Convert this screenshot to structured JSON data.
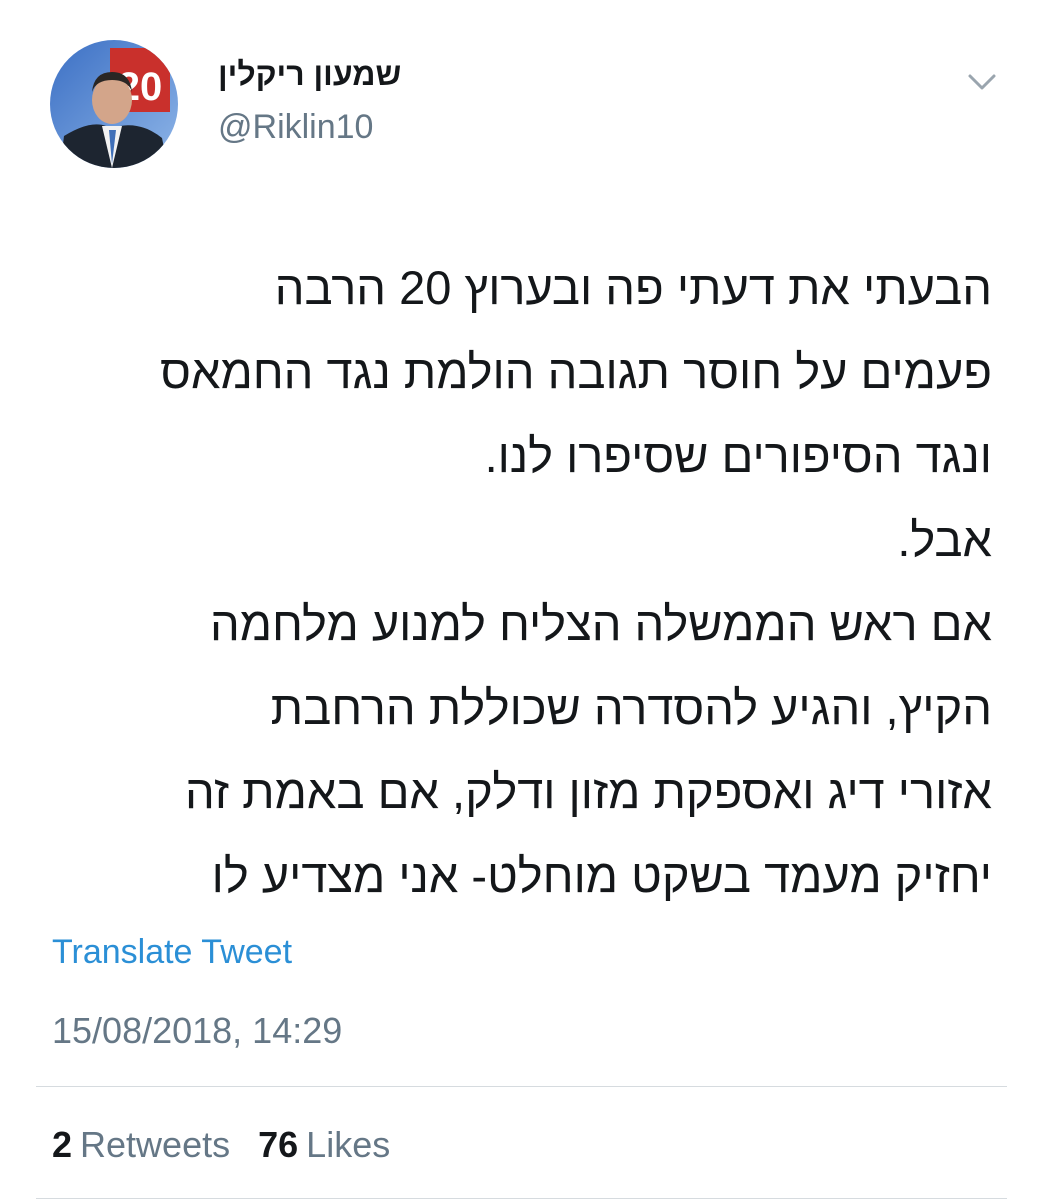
{
  "author": {
    "display_name": "שמעון ריקלין",
    "handle": "@Riklin10",
    "avatar_text": "20"
  },
  "tweet": {
    "lines": [
      "הבעתי את דעתי פה ובערוץ 20 הרבה",
      "פעמים על חוסר תגובה הולמת נגד החמאס",
      "ונגד הסיפורים שסיפרו לנו.",
      "אבל.",
      "אם ראש הממשלה הצליח למנוע מלחמה",
      "הקיץ, והגיע להסדרה שכוללת הרחבת",
      "אזורי דיג ואספקת מזון ודלק, אם באמת זה",
      "יחזיק מעמד בשקט מוחלט- אני מצדיע לו"
    ],
    "translate_label": "Translate Tweet",
    "timestamp": "15/08/2018, 14:29"
  },
  "stats": {
    "retweets_count": "2",
    "retweets_label": "Retweets",
    "likes_count": "76",
    "likes_label": "Likes"
  },
  "icons": {
    "menu": "chevron-down-icon"
  },
  "colors": {
    "link": "#2b8fd6",
    "secondary_text": "#657786",
    "primary_text": "#14171a",
    "divider": "#d6dbdf"
  }
}
